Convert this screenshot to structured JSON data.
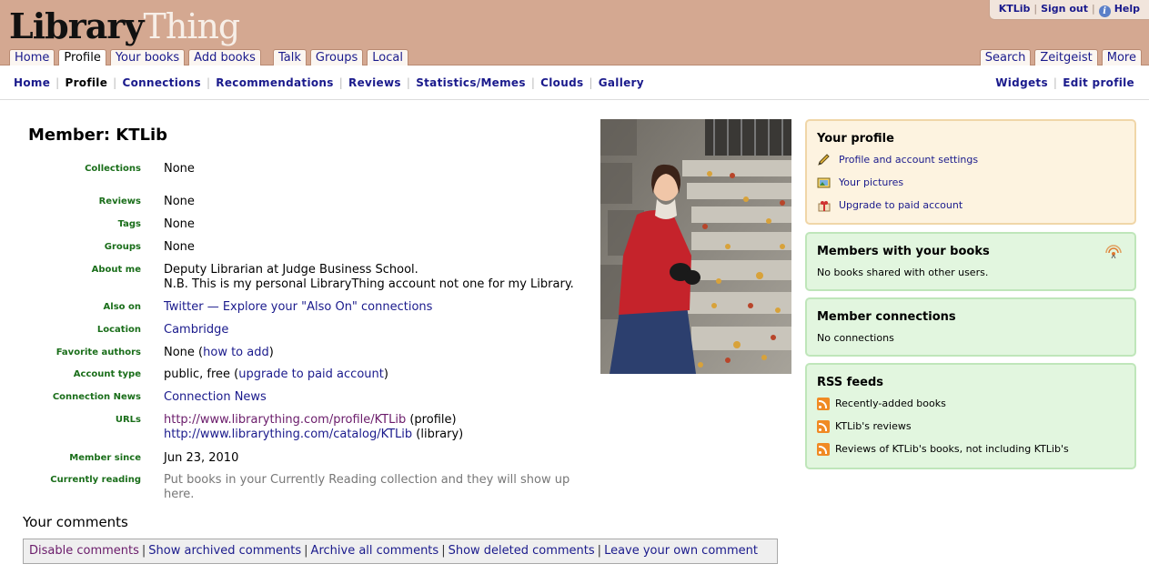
{
  "header": {
    "logo_part1": "Library",
    "logo_part2": "Thing",
    "user": {
      "username": "KTLib",
      "sign_out": "Sign out",
      "help": "Help"
    },
    "tabs_left": [
      "Home",
      "Profile",
      "Your books",
      "Add books"
    ],
    "tabs_mid": [
      "Talk",
      "Groups",
      "Local"
    ],
    "tabs_right": [
      "Search",
      "Zeitgeist",
      "More"
    ],
    "active_tab": "Profile"
  },
  "subnav": {
    "left": [
      "Home",
      "Profile",
      "Connections",
      "Recommendations",
      "Reviews",
      "Statistics/Memes",
      "Clouds",
      "Gallery"
    ],
    "right": [
      "Widgets",
      "Edit profile"
    ],
    "current": "Profile"
  },
  "profile": {
    "title": "Member: KTLib",
    "rows": {
      "collections": {
        "label": "Collections",
        "value": "None"
      },
      "reviews": {
        "label": "Reviews",
        "value": "None"
      },
      "tags": {
        "label": "Tags",
        "value": "None"
      },
      "groups": {
        "label": "Groups",
        "value": "None"
      },
      "about": {
        "label": "About me",
        "line1": "Deputy Librarian at Judge Business School.",
        "line2": "N.B. This is my personal LibraryThing account not one for my Library."
      },
      "also_on": {
        "label": "Also on",
        "link": "Twitter — Explore your \"Also On\" connections"
      },
      "location": {
        "label": "Location",
        "link": "Cambridge"
      },
      "favorite_authors": {
        "label": "Favorite authors",
        "prefix": "None (",
        "link": "how to add",
        "suffix": ")"
      },
      "account_type": {
        "label": "Account type",
        "prefix": "public, free (",
        "link": "upgrade to paid account",
        "suffix": ")"
      },
      "connection_news": {
        "label": "Connection News",
        "link": "Connection News"
      },
      "urls": {
        "label": "URLs",
        "url1": "http://www.librarything.com/profile/KTLib",
        "url1_note": " (profile)",
        "url2": "http://www.librarything.com/catalog/KTLib",
        "url2_note": " (library)"
      },
      "member_since": {
        "label": "Member since",
        "value": "Jun 23, 2010"
      },
      "currently_reading": {
        "label": "Currently reading",
        "value": "Put books in your Currently Reading collection and they will show up here."
      }
    }
  },
  "comments": {
    "title": "Your comments",
    "links": [
      "Disable comments",
      "Show archived comments",
      "Archive all comments",
      "Show deleted comments",
      "Leave your own comment"
    ]
  },
  "sidebar": {
    "your_profile": {
      "title": "Your profile",
      "items": [
        {
          "label": "Profile and account settings",
          "icon": "pencil-icon"
        },
        {
          "label": "Your pictures",
          "icon": "pictures-icon"
        },
        {
          "label": "Upgrade to paid account",
          "icon": "gift-icon"
        }
      ]
    },
    "members_with_books": {
      "title": "Members with your books",
      "text": "No books shared with other users."
    },
    "member_connections": {
      "title": "Member connections",
      "text": "No connections"
    },
    "rss": {
      "title": "RSS feeds",
      "items": [
        "Recently-added books",
        "KTLib's reviews",
        "Reviews of KTLib's books, not including KTLib's"
      ]
    }
  },
  "colors": {
    "header_bg": "#d4a891",
    "link": "#1a1a8c",
    "label_green": "#1a6e1a",
    "box_yellow": "#fdf3e0",
    "box_green": "#e2f6df",
    "rss_orange": "#f08a24"
  }
}
